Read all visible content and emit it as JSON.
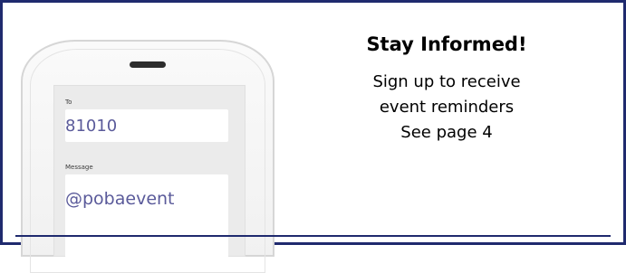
{
  "phone": {
    "to_label": "To",
    "to_value": "81010",
    "message_label": "Message",
    "message_value": "@pobaevent"
  },
  "info": {
    "title": "Stay Informed!",
    "line1": "Sign up to receive",
    "line2": "event reminders",
    "line3": "See page 4"
  },
  "colors": {
    "border": "#1f2a6e",
    "value_text": "#5a5a9a",
    "screen_bg": "#ebebeb"
  }
}
